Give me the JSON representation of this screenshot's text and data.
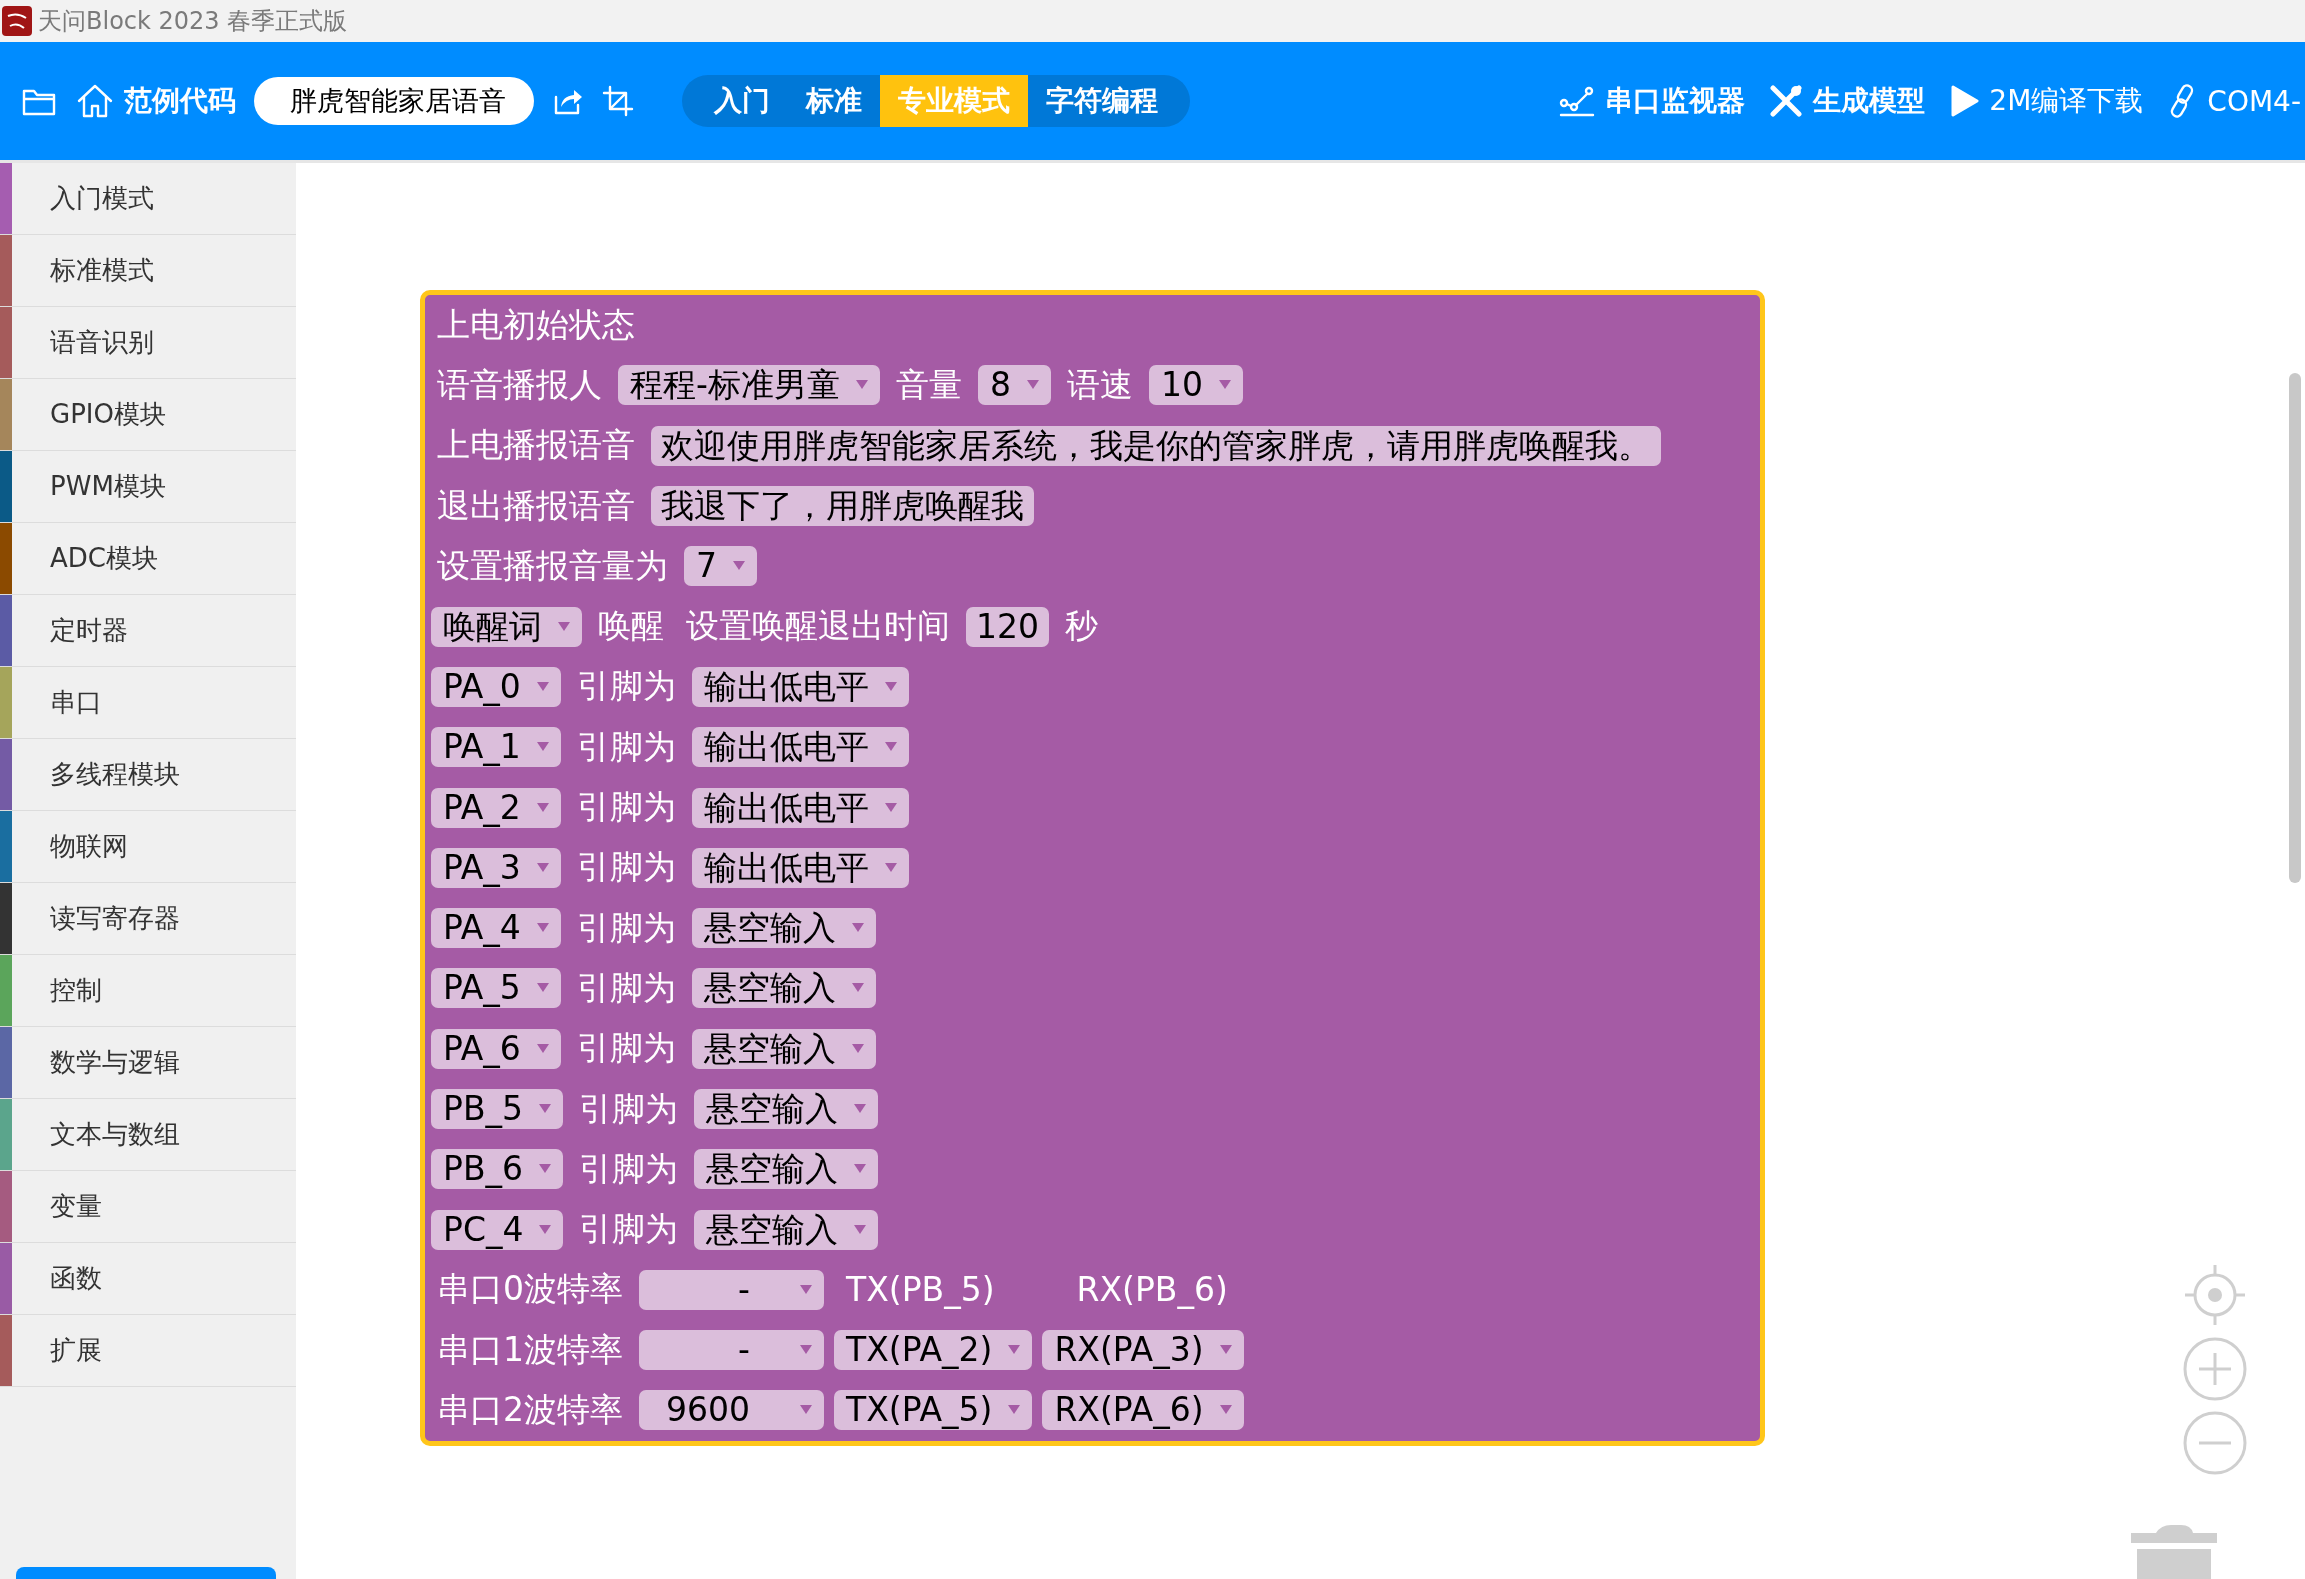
{
  "title_bar": {
    "title": "天问Block 2023 春季正式版"
  },
  "toolbar": {
    "examples_button": "范例代码",
    "project_name": "胖虎智能家居语音",
    "modes": [
      {
        "label": "入门",
        "selected": false
      },
      {
        "label": "标准",
        "selected": false
      },
      {
        "label": "专业模式",
        "selected": true
      },
      {
        "label": "字符编程",
        "selected": false
      }
    ],
    "actions": [
      {
        "label": "串口监视器",
        "kind": "monitor"
      },
      {
        "label": "生成模型",
        "kind": "model"
      },
      {
        "label": "2M编译下载",
        "kind": "compile"
      },
      {
        "label": "COM4-",
        "kind": "port"
      }
    ]
  },
  "sidebar": {
    "items": [
      {
        "label": "入门模式",
        "color": "#a55db0"
      },
      {
        "label": "标准模式",
        "color": "#a55b5b"
      },
      {
        "label": "语音识别",
        "color": "#a55b5b"
      },
      {
        "label": "GPIO模块",
        "color": "#a5865b"
      },
      {
        "label": "PWM模块",
        "color": "#0b5a87"
      },
      {
        "label": "ADC模块",
        "color": "#8b4a00"
      },
      {
        "label": "定时器",
        "color": "#5b5ba5"
      },
      {
        "label": "串口",
        "color": "#a5a55b"
      },
      {
        "label": "多线程模块",
        "color": "#745ba5"
      },
      {
        "label": "物联网",
        "color": "#1a6ea0"
      },
      {
        "label": "读写寄存器",
        "color": "#333333"
      },
      {
        "label": "控制",
        "color": "#5ba55b"
      },
      {
        "label": "数学与逻辑",
        "color": "#5b67a5"
      },
      {
        "label": "文本与数组",
        "color": "#5ba58c"
      },
      {
        "label": "变量",
        "color": "#a55b80"
      },
      {
        "label": "函数",
        "color": "#995ba5"
      },
      {
        "label": "扩展",
        "color": "#a55b5b"
      }
    ]
  },
  "block": {
    "rows": [
      {
        "items": [
          {
            "kind": "label",
            "text": "上电初始状态"
          }
        ]
      },
      {
        "items": [
          {
            "kind": "label",
            "text": "语音播报人"
          },
          {
            "kind": "dropdown",
            "text": "程程-标准男童"
          },
          {
            "kind": "label",
            "text": "音量"
          },
          {
            "kind": "dropdown",
            "text": "8"
          },
          {
            "kind": "label",
            "text": "语速"
          },
          {
            "kind": "dropdown",
            "text": "10"
          }
        ]
      },
      {
        "items": [
          {
            "kind": "label",
            "text": "上电播报语音"
          },
          {
            "kind": "field",
            "text": "欢迎使用胖虎智能家居系统，我是你的管家胖虎，请用胖虎唤醒我。"
          }
        ]
      },
      {
        "items": [
          {
            "kind": "label",
            "text": "退出播报语音"
          },
          {
            "kind": "field",
            "text": "我退下了，用胖虎唤醒我"
          }
        ]
      },
      {
        "items": [
          {
            "kind": "label",
            "text": "设置播报音量为"
          },
          {
            "kind": "dropdown",
            "text": "7"
          }
        ]
      },
      {
        "items": [
          {
            "kind": "dropdown",
            "text": "唤醒词"
          },
          {
            "kind": "label",
            "text": "唤醒"
          },
          {
            "kind": "label",
            "text": "设置唤醒退出时间"
          },
          {
            "kind": "field",
            "text": "120"
          },
          {
            "kind": "label",
            "text": "秒"
          }
        ]
      },
      {
        "items": [
          {
            "kind": "dropdown",
            "text": "PA_0"
          },
          {
            "kind": "label",
            "text": "引脚为"
          },
          {
            "kind": "dropdown",
            "text": "输出低电平"
          }
        ]
      },
      {
        "items": [
          {
            "kind": "dropdown",
            "text": "PA_1"
          },
          {
            "kind": "label",
            "text": "引脚为"
          },
          {
            "kind": "dropdown",
            "text": "输出低电平"
          }
        ]
      },
      {
        "items": [
          {
            "kind": "dropdown",
            "text": "PA_2"
          },
          {
            "kind": "label",
            "text": "引脚为"
          },
          {
            "kind": "dropdown",
            "text": "输出低电平"
          }
        ]
      },
      {
        "items": [
          {
            "kind": "dropdown",
            "text": "PA_3"
          },
          {
            "kind": "label",
            "text": "引脚为"
          },
          {
            "kind": "dropdown",
            "text": "输出低电平"
          }
        ]
      },
      {
        "items": [
          {
            "kind": "dropdown",
            "text": "PA_4"
          },
          {
            "kind": "label",
            "text": "引脚为"
          },
          {
            "kind": "dropdown",
            "text": "悬空输入"
          }
        ]
      },
      {
        "items": [
          {
            "kind": "dropdown",
            "text": "PA_5"
          },
          {
            "kind": "label",
            "text": "引脚为"
          },
          {
            "kind": "dropdown",
            "text": "悬空输入"
          }
        ]
      },
      {
        "items": [
          {
            "kind": "dropdown",
            "text": "PA_6"
          },
          {
            "kind": "label",
            "text": "引脚为"
          },
          {
            "kind": "dropdown",
            "text": "悬空输入"
          }
        ]
      },
      {
        "items": [
          {
            "kind": "dropdown",
            "text": "PB_5"
          },
          {
            "kind": "label",
            "text": "引脚为"
          },
          {
            "kind": "dropdown",
            "text": "悬空输入"
          }
        ]
      },
      {
        "items": [
          {
            "kind": "dropdown",
            "text": "PB_6"
          },
          {
            "kind": "label",
            "text": "引脚为"
          },
          {
            "kind": "dropdown",
            "text": "悬空输入"
          }
        ]
      },
      {
        "items": [
          {
            "kind": "dropdown",
            "text": "PC_4"
          },
          {
            "kind": "label",
            "text": "引脚为"
          },
          {
            "kind": "dropdown",
            "text": "悬空输入"
          }
        ]
      },
      {
        "items": [
          {
            "kind": "label",
            "text": "串口0波特率"
          },
          {
            "kind": "baud",
            "text": "-"
          },
          {
            "kind": "pin",
            "text": "TX(PB_5)"
          },
          {
            "kind": "pin",
            "text": "RX(PB_6)"
          }
        ]
      },
      {
        "items": [
          {
            "kind": "label",
            "text": "串口1波特率"
          },
          {
            "kind": "baud",
            "text": "-"
          },
          {
            "kind": "dropdown",
            "text": "TX(PA_2)"
          },
          {
            "kind": "dropdown",
            "text": "RX(PA_3)"
          }
        ]
      },
      {
        "items": [
          {
            "kind": "label",
            "text": "串口2波特率"
          },
          {
            "kind": "baud",
            "text": "9600"
          },
          {
            "kind": "dropdown",
            "text": "TX(PA_5)"
          },
          {
            "kind": "dropdown",
            "text": "RX(PA_6)"
          }
        ]
      }
    ]
  }
}
